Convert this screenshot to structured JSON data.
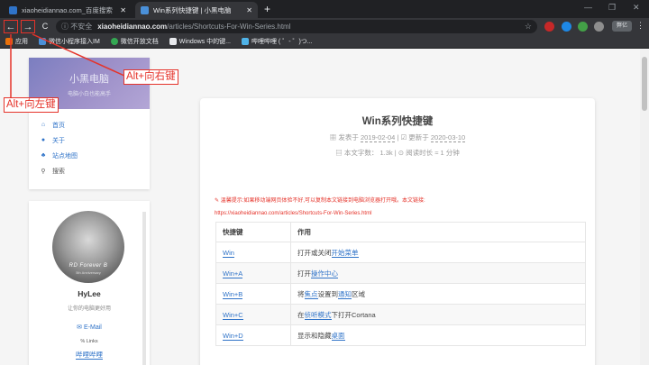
{
  "browser": {
    "tabs": [
      {
        "title": "xiaoheidiannao.com_百度搜索",
        "state": "inactive"
      },
      {
        "title": "Win系列快捷键 | 小黑电脑",
        "state": "active"
      }
    ],
    "new_tab_glyph": "+",
    "window_controls": [
      "—",
      "❐",
      "✕"
    ],
    "toolbar": {
      "back_glyph": "←",
      "forward_glyph": "→",
      "reload_glyph": "C",
      "security_label": "不安全",
      "url_domain": "xiaoheidiannao.com",
      "url_path": "/articles/Shortcuts-For-Win-Series.html",
      "star_glyph": "☆",
      "profile_label": "弊亿",
      "menu_glyph": "⋮"
    },
    "bookmarks": [
      {
        "label": "应用",
        "icon": "apps-grid-icon",
        "color": "#e8710a"
      },
      {
        "label": "微信小程序接入IM",
        "icon": "cloud-icon",
        "color": "#4a90d9"
      },
      {
        "label": "微信开放文档",
        "icon": "wechat-icon",
        "color": "#34a853"
      },
      {
        "label": "Windows 中的键...",
        "icon": "windows-icon",
        "color": "#e8eaed"
      },
      {
        "label": "哔哩哔哩 ( ゜- ゜)つ...",
        "icon": "bilibili-icon",
        "color": "#4fb3e8"
      }
    ]
  },
  "sidebar": {
    "site_name": "小黑电脑",
    "slogan": "电脑小白也能高手",
    "nav": [
      {
        "label": "首页",
        "icon": "home-icon",
        "glyph": "⌂"
      },
      {
        "label": "关于",
        "icon": "user-icon",
        "glyph": "●"
      },
      {
        "label": "站点地图",
        "icon": "sitemap-icon",
        "glyph": "♣"
      },
      {
        "label": "搜索",
        "icon": "search-icon",
        "glyph": "⚲"
      }
    ],
    "profile": {
      "avatar_text": "RD Forever B",
      "avatar_subtext": "5th Anniversary",
      "name": "HyLee",
      "desc": "让你的电脑更好用",
      "email_label": "E-Mail",
      "links_label": "Links",
      "bilibili_label": "哔哩哔哩"
    }
  },
  "article": {
    "title": "Win系列快捷键",
    "published_label": "发表于",
    "published_date": "2019-02-04",
    "updated_label": "更新于",
    "updated_date": "2020-03-10",
    "wordcount_label": "本文字数：",
    "wordcount_value": "1.3k",
    "readtime_label": "阅读时长 ≈",
    "readtime_value": "1 分钟",
    "tip_text": "温馨提示:如果移动端网页体验不好,可以复制本文链接到电脑浏览器打开哦。本文链接:",
    "tip_url": "https://xiaoheidiannao.com/articles/Shortcuts-For-Win-Series.html",
    "table_headers": [
      "快捷键",
      "作用"
    ],
    "rows": [
      {
        "key": "Win",
        "action_pre": "打开或关闭",
        "action_link": "开始菜单",
        "action_post": ""
      },
      {
        "key": "Win+A",
        "action_pre": "打开",
        "action_link": "操作中心",
        "action_post": ""
      },
      {
        "key": "Win+B",
        "action_pre": "将",
        "action_link": "焦点",
        "action_mid": "设置到",
        "action_link2": "通知",
        "action_post": "区域"
      },
      {
        "key": "Win+C",
        "action_pre": "在",
        "action_link": "侦听模式",
        "action_post": "下打开Cortana"
      },
      {
        "key": "Win+D",
        "action_pre": "显示和隐藏",
        "action_link": "桌面",
        "action_post": ""
      }
    ]
  },
  "annotations": {
    "forward_label": "Alt+向右键",
    "back_label": "Alt+向左键",
    "color": "#e5332a"
  }
}
